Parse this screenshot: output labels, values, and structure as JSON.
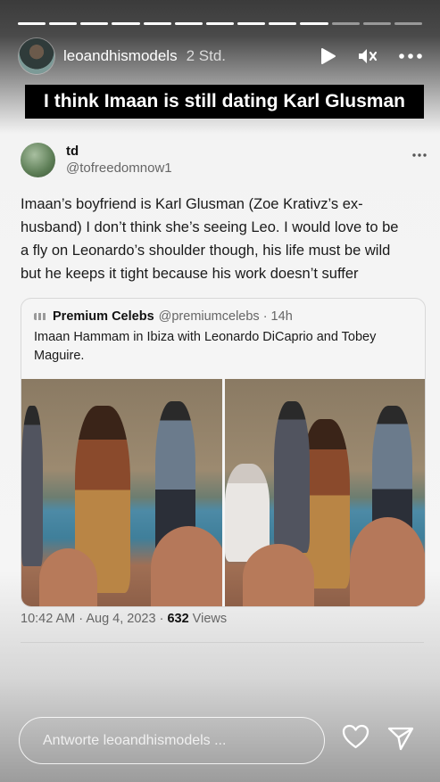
{
  "story": {
    "progress_segments_total": 13,
    "progress_segments_done": 10,
    "username": "leoandhismodels",
    "time_ago": "2 Std.",
    "banner_text": "I think Imaan is still dating Karl Glusman",
    "icons": [
      "play-icon",
      "mute-icon",
      "more-icon"
    ]
  },
  "tweet": {
    "name": "td",
    "handle": "@tofreedomnow1",
    "text": "Imaan’s boyfriend is Karl Glusman (Zoe Krativz’s ex-husband) I don’t think she’s seeing Leo. I would love to be a fly on Leonardo’s shoulder though, his life must be wild but he keeps it tight because his work doesn’t suffer",
    "quote": {
      "name": "Premium Celebs",
      "handle": "@premiumcelebs · 14h",
      "text": "Imaan Hammam in Ibiza with Leonardo DiCaprio and Tobey Maguire."
    },
    "timestamp": "10:42 AM · Aug 4, 2023 · ",
    "views_count": "632",
    "views_label": " Views"
  },
  "reply": {
    "placeholder": "Antworte leoandhismodels ..."
  }
}
